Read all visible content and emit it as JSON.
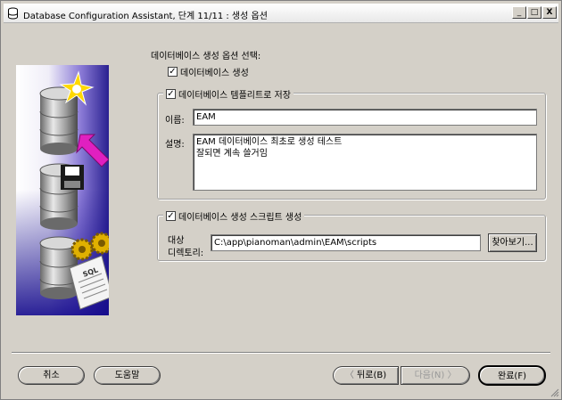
{
  "window": {
    "title": "Database Configuration Assistant, 단계 11/11 : 생성 옵션",
    "controls": {
      "minimize": "_",
      "maximize": "□",
      "close": "X"
    }
  },
  "main": {
    "heading": "데이터베이스 생성 옵션 선택:",
    "create_db": {
      "label": "데이터베이스 생성",
      "checked": true
    },
    "save_template": {
      "label": "데이터베이스 템플리트로 저장",
      "checked": true,
      "name_label": "이름:",
      "name_value": "EAM",
      "desc_label": "설명:",
      "desc_value": "EAM 데이터베이스 최초로 생성 테스트\n잘되면 계속 쓸거임"
    },
    "gen_scripts": {
      "label": "데이터베이스 생성 스크립트 생성",
      "checked": true,
      "dir_label_line1": "대상",
      "dir_label_line2": "디렉토리:",
      "dir_value": "C:\\app\\pianoman\\admin\\EAM\\scripts",
      "browse_label": "찾아보기..."
    }
  },
  "footer": {
    "cancel": "취소",
    "help": "도움말",
    "back": "뒤로(B)",
    "next": "다음(N)",
    "finish": "완료(F)"
  },
  "art": {
    "sql_text": "SQL"
  },
  "colors": {
    "accent_arrow": "#e020c0",
    "star": "#ffd800",
    "panel_dark": "#2a2190"
  }
}
